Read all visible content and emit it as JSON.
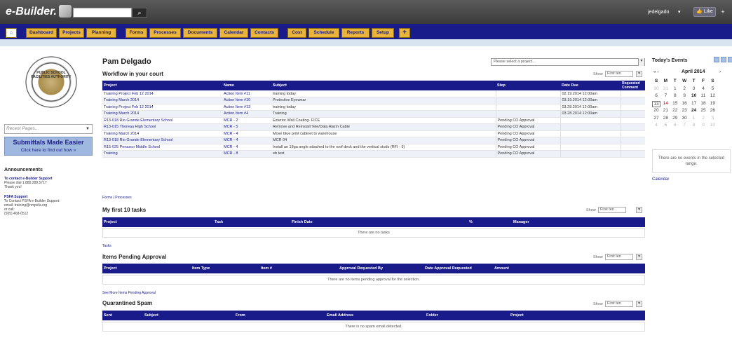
{
  "app": {
    "logo": "e-Builder.",
    "search_btn": "⌕",
    "user": "jedelgado",
    "user_caret": "▾",
    "like": "👍 Like",
    "like_plus": "+"
  },
  "nav": {
    "home": "⌂",
    "tabs": [
      "Dashboard",
      "Projects",
      "Planning",
      "Forms",
      "Processes",
      "Documents",
      "Calendar",
      "Contacts",
      "Cost",
      "Schedule",
      "Reports",
      "Setup"
    ],
    "plus": "+"
  },
  "left": {
    "seal_text": "PUBLIC SCHOOL FACILITIES AUTHORITY",
    "recent_placeholder": "Recent Pages...",
    "submittals_title": "Submittals Made Easier",
    "submittals_link": "Click here to find out how »",
    "ann_heading": "Announcements",
    "ann1_title": "To contact e-Builder Support",
    "ann1_lines": [
      "Please dial 1.888.288.5717",
      "Thank you!"
    ],
    "ann2_title": "PSFA Support",
    "ann2_lines": [
      "To Contact PSFA e-Builder Support:",
      "email: training@nmpsfa.org",
      "or call:",
      "(505) 468-0512"
    ]
  },
  "main": {
    "user_name": "Pam Delgado",
    "project_select": "Please select a project...",
    "workflow": {
      "heading": "Workflow in your court",
      "show_label": "Show",
      "show_value": "First ten",
      "columns": [
        "Project",
        "Name",
        "Subject",
        "Step",
        "Date Due",
        "Requested Comment"
      ],
      "rows": [
        [
          "Training Project Feb 12 2014",
          "Action Item #11",
          "training today",
          "",
          "02.19.2014 12:00am",
          ""
        ],
        [
          "Training March 2014",
          "Action Item #10",
          "Protective Eyewear",
          "",
          "03.19.2014 12:00am",
          ""
        ],
        [
          "Training Project Feb 12 2014",
          "Action Item #13",
          "training today",
          "",
          "03.28.2014 12:00am",
          ""
        ],
        [
          "Training March 2014",
          "Action Item #4",
          "Training",
          "",
          "03.28.2014 12:00am",
          ""
        ],
        [
          "R13-018 Rio Grande Elementary School",
          "MCR - 2",
          "Exterior Wall Coating- FICE",
          "Pending CO Approval",
          "",
          ""
        ],
        [
          "R13-015 Thoreau High School",
          "MCR - 5",
          "Remove and Reinstall Tele/Data Alarm Cable",
          "Pending CO Approval",
          "",
          ""
        ],
        [
          "Training March 2014",
          "MCR - 4",
          "Move blue print cabinet to warehouse",
          "Pending CO Approval",
          "",
          ""
        ],
        [
          "R13-018 Rio Grande Elementary School",
          "MCR - 4",
          "MCR 04",
          "Pending CO Approval",
          "",
          ""
        ],
        [
          "R15-025 Penasco Middle School",
          "MCR - 4",
          "Install an 18ga angle attached to the roof deck and the vertical studs (RFI - 5)",
          "Pending CO Approval",
          "",
          ""
        ],
        [
          "Training",
          "MCR - 8",
          "eb test",
          "Pending CO Approval",
          "",
          ""
        ]
      ],
      "footer": "Forms | Processes"
    },
    "tasks": {
      "heading": "My first 10 tasks",
      "show_label": "Show",
      "show_value": "First ten",
      "columns": [
        "Project",
        "Task",
        "Finish Date",
        "%",
        "Manager"
      ],
      "empty": "There are no tasks",
      "footer": "Tasks"
    },
    "pending": {
      "heading": "Items Pending Approval",
      "show_label": "Show",
      "show_value": "First ten",
      "columns": [
        "Project",
        "Item Type",
        "Item #",
        "Approval Requested By",
        "Date Approval Requested",
        "Amount"
      ],
      "empty": "There are no items pending approval for the selection.",
      "footer": "See More Items Pending Approval"
    },
    "spam": {
      "heading": "Quarantined Spam",
      "show_label": "Show",
      "show_value": "First ten",
      "columns": [
        "Sent",
        "Subject",
        "From",
        "Email Address",
        "Folder",
        "Project"
      ],
      "empty": "There is no spam email detected."
    }
  },
  "right": {
    "events_heading": "Today's Events",
    "month": "April 2014",
    "prev": "« ‹",
    "next": "›",
    "days_header": [
      "S",
      "M",
      "T",
      "W",
      "T",
      "F",
      "S"
    ],
    "weeks": [
      [
        "30",
        "31",
        "1",
        "2",
        "3",
        "4",
        "5"
      ],
      [
        "6",
        "7",
        "8",
        "9",
        "10",
        "11",
        "12"
      ],
      [
        "13",
        "14",
        "15",
        "16",
        "17",
        "18",
        "19"
      ],
      [
        "20",
        "21",
        "22",
        "23",
        "24",
        "25",
        "26"
      ],
      [
        "27",
        "28",
        "29",
        "30",
        "1",
        "2",
        "3"
      ],
      [
        "4",
        "5",
        "6",
        "7",
        "8",
        "9",
        "10"
      ]
    ],
    "no_events": "There are no events in the selected range.",
    "calendar_link": "Calendar"
  }
}
